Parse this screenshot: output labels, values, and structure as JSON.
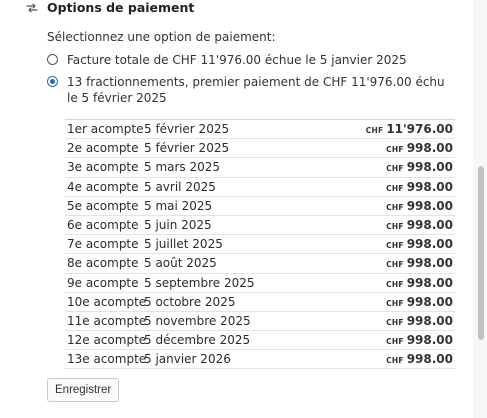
{
  "header": {
    "title": "Options de paiement",
    "icon": "refresh-arrows-icon"
  },
  "prompt": "Sélectionnez une option de paiement:",
  "options": [
    {
      "label": "Facture totale de CHF 11'976.00 échue le 5 janvier 2025",
      "selected": false
    },
    {
      "label": "13 fractionnements, premier paiement de CHF 11'976.00 échu le 5 février 2025",
      "selected": true
    }
  ],
  "schedule": [
    {
      "name": "1er acompte",
      "date": "5 février 2025",
      "currency": "CHF",
      "amount": "11'976.00"
    },
    {
      "name": "2e acompte",
      "date": "5 février 2025",
      "currency": "CHF",
      "amount": "998.00"
    },
    {
      "name": "3e acompte",
      "date": "5 mars 2025",
      "currency": "CHF",
      "amount": "998.00"
    },
    {
      "name": "4e acompte",
      "date": "5 avril 2025",
      "currency": "CHF",
      "amount": "998.00"
    },
    {
      "name": "5e acompte",
      "date": "5 mai 2025",
      "currency": "CHF",
      "amount": "998.00"
    },
    {
      "name": "6e acompte",
      "date": "5 juin 2025",
      "currency": "CHF",
      "amount": "998.00"
    },
    {
      "name": "7e acompte",
      "date": "5 juillet 2025",
      "currency": "CHF",
      "amount": "998.00"
    },
    {
      "name": "8e acompte",
      "date": "5 août 2025",
      "currency": "CHF",
      "amount": "998.00"
    },
    {
      "name": "9e acompte",
      "date": "5 septembre 2025",
      "currency": "CHF",
      "amount": "998.00"
    },
    {
      "name": "10e acompte",
      "date": "5 octobre 2025",
      "currency": "CHF",
      "amount": "998.00"
    },
    {
      "name": "11e acompte",
      "date": "5 novembre 2025",
      "currency": "CHF",
      "amount": "998.00"
    },
    {
      "name": "12e acompte",
      "date": "5 décembre 2025",
      "currency": "CHF",
      "amount": "998.00"
    },
    {
      "name": "13e acompte",
      "date": "5 janvier 2026",
      "currency": "CHF",
      "amount": "998.00"
    }
  ],
  "save_button": "Enregistrer",
  "colors": {
    "accent": "#1f6fb2",
    "divider": "#e3e3e3"
  }
}
